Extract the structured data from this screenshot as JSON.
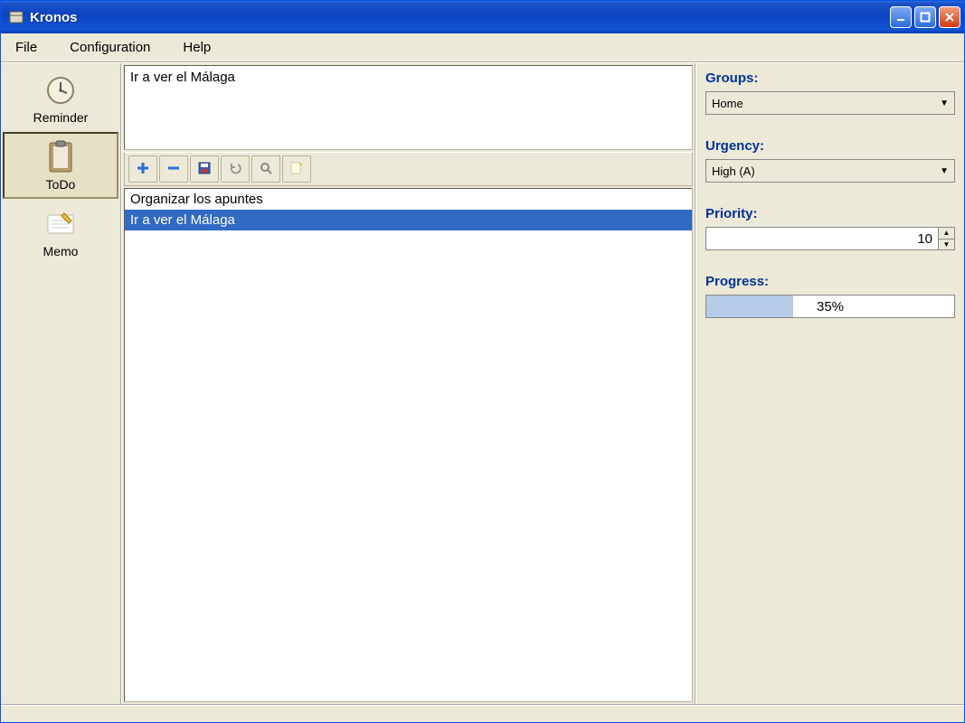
{
  "window": {
    "title": "Kronos"
  },
  "menu": {
    "file": "File",
    "configuration": "Configuration",
    "help": "Help"
  },
  "sidebar": {
    "items": [
      {
        "id": "reminder",
        "label": "Reminder"
      },
      {
        "id": "todo",
        "label": "ToDo"
      },
      {
        "id": "memo",
        "label": "Memo"
      }
    ],
    "selected": "todo"
  },
  "detail": {
    "text": "Ir a ver el Málaga"
  },
  "toolbar": {
    "add": "Add",
    "remove": "Remove",
    "save": "Save",
    "undo": "Undo",
    "search": "Search",
    "new_note": "New note"
  },
  "list": {
    "items": [
      {
        "label": "Organizar los apuntes",
        "selected": false
      },
      {
        "label": "Ir a ver el Málaga",
        "selected": true
      }
    ]
  },
  "props": {
    "groups_label": "Groups:",
    "groups_value": "Home",
    "urgency_label": "Urgency:",
    "urgency_value": "High (A)",
    "priority_label": "Priority:",
    "priority_value": "10",
    "progress_label": "Progress:",
    "progress_value": 35,
    "progress_text": "35%"
  }
}
